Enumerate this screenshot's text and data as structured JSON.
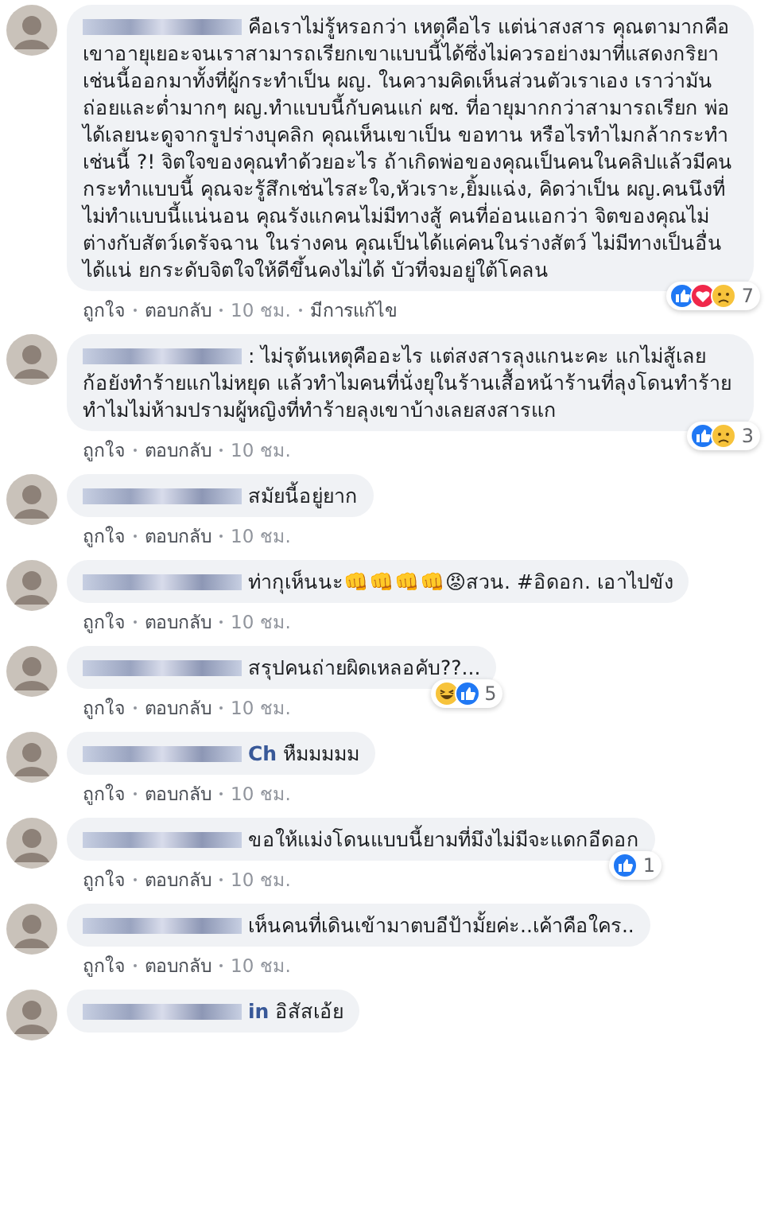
{
  "comments": [
    {
      "text": "คือเราไม่รู้หรอกว่า เหตุคือไร แต่น่าสงสาร คุณตามากคือเขาอายุเยอะจนเราสามารถเรียกเขาแบบนี้ได้ซึ่งไม่ควรอย่างมาที่แสดงกริยาเช่นนี้ออกมาทั้งที่ผู้กระทำเป็น ผญ. ในความคิดเห็นส่วนตัวเราเอง เราว่ามันถ่อยและต่ำมากๆ ผญ.ทำแบบนี้กับคนแก่ ผช. ที่อายุมากกว่าสามารถเรียก พ่อ ได้เลยนะดูจากรูปร่างบุคลิก คุณเห็นเขาเป็น ขอทาน หรือไรทำไมกล้ากระทำเช่นนี้ ?! จิตใจของคุณทำด้วยอะไร ถ้าเกิดพ่อของคุณเป็นคนในคลิปแล้วมีคนกระทำแบบนี้ คุณจะรู้สึกเช่นไรสะใจ,หัวเราะ,ยิ้มแฉ่ง, คิดว่าเป็น ผญ.คนนึงที่ไม่ทำแบบนี้แน่นอน คุณรังแกคนไม่มีทางสู้ คนที่อ่อนแอกว่า จิตของคุณไม่ต่างกับสัตว์เดรัจฉาน ในร่างคน คุณเป็นได้แค่คนในร่างสัตว์ ไม่มีทางเป็นอื่นได้แน่ ยกระดับจิตใจให้ดีขึ้นคงไม่ได้ บัวที่จมอยู่ใต้โคลน",
      "reactions": [
        {
          "kind": "like"
        },
        {
          "kind": "love"
        },
        {
          "kind": "sad"
        }
      ],
      "reaction_count": "7",
      "actions": [
        {
          "kind": "link",
          "label": "ถูกใจ"
        },
        {
          "kind": "link",
          "label": "ตอบกลับ"
        },
        {
          "kind": "time",
          "label": "10 ชม."
        },
        {
          "kind": "link",
          "label": "มีการแก้ไข"
        }
      ]
    },
    {
      "text": ": ไม่รุต้นเหตุคืออะไร แต่สงสารลุงแกนะคะ แกไม่สู้เลย ก้อยังทำร้ายแกไม่หยุด แล้วทำไมคนที่นั่งยุในร้านเสื้อหน้าร้านที่ลุงโดนทำร้ายทำไมไม่ห้ามปรามผู้หญิงที่ทำร้ายลุงเขาบ้างเลยสงสารแก",
      "reactions": [
        {
          "kind": "like"
        },
        {
          "kind": "sad"
        }
      ],
      "reaction_count": "3",
      "actions": [
        {
          "kind": "link",
          "label": "ถูกใจ"
        },
        {
          "kind": "link",
          "label": "ตอบกลับ"
        },
        {
          "kind": "time",
          "label": "10 ชม."
        }
      ]
    },
    {
      "text": "สมัยนี้อยู่ยาก",
      "actions": [
        {
          "kind": "link",
          "label": "ถูกใจ"
        },
        {
          "kind": "link",
          "label": "ตอบกลับ"
        },
        {
          "kind": "time",
          "label": "10 ชม."
        }
      ]
    },
    {
      "text": "ท่ากุเห็นนะ👊👊👊👊😡สวน. #อิดอก. เอาไปขัง",
      "actions": [
        {
          "kind": "link",
          "label": "ถูกใจ"
        },
        {
          "kind": "link",
          "label": "ตอบกลับ"
        },
        {
          "kind": "time",
          "label": "10 ชม."
        }
      ]
    },
    {
      "text": "สรุปคนถ่ายผิดเหลอคับ??...",
      "reactions": [
        {
          "kind": "haha"
        },
        {
          "kind": "like"
        }
      ],
      "reaction_count": "5",
      "actions": [
        {
          "kind": "link",
          "label": "ถูกใจ"
        },
        {
          "kind": "link",
          "label": "ตอบกลับ"
        },
        {
          "kind": "time",
          "label": "10 ชม."
        }
      ]
    },
    {
      "name_tail": "Ch",
      "text": "หืมมมมม",
      "actions": [
        {
          "kind": "link",
          "label": "ถูกใจ"
        },
        {
          "kind": "link",
          "label": "ตอบกลับ"
        },
        {
          "kind": "time",
          "label": "10 ชม."
        }
      ]
    },
    {
      "text": "ขอให้แม่งโดนแบบนี้ยามที่มึงไม่มีจะแดกอีดอก",
      "reactions": [
        {
          "kind": "like"
        }
      ],
      "reaction_count": "1",
      "actions": [
        {
          "kind": "link",
          "label": "ถูกใจ"
        },
        {
          "kind": "link",
          "label": "ตอบกลับ"
        },
        {
          "kind": "time",
          "label": "10 ชม."
        }
      ]
    },
    {
      "text": "เห็นคนที่เดินเข้ามาตบอีป้ามั้ยค่ะ..เค้าคือใคร..",
      "actions": [
        {
          "kind": "link",
          "label": "ถูกใจ"
        },
        {
          "kind": "link",
          "label": "ตอบกลับ"
        },
        {
          "kind": "time",
          "label": "10 ชม."
        }
      ]
    },
    {
      "name_tail": "in",
      "text": "อิสัสเอ้ย"
    }
  ]
}
